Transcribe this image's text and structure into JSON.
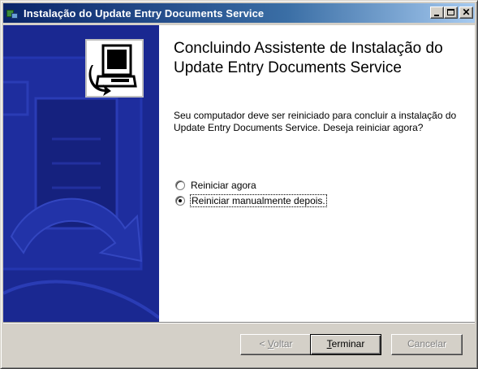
{
  "window": {
    "title": "Instalação do Update Entry Documents Service",
    "controls": [
      "minimize-icon",
      "maximize-icon",
      "close-icon"
    ]
  },
  "banner": {
    "logo_icon": "computer-install-icon",
    "colors": {
      "background": "#1c2a93",
      "accent": "#2233a8"
    }
  },
  "main": {
    "heading": "Concluindo Assistente de Instalação do Update Entry Documents Service",
    "description": "Seu computador deve ser reiniciado para concluir a instalação do Update Entry Documents Service. Deseja reiniciar agora?",
    "options": [
      {
        "label": "Reiniciar agora",
        "checked": false
      },
      {
        "label": "Reiniciar manualmente depois.",
        "checked": true
      }
    ]
  },
  "buttons": {
    "back": {
      "prefix": "< ",
      "accel": "V",
      "rest": "oltar",
      "enabled": false
    },
    "finish": {
      "accel": "T",
      "rest": "erminar",
      "enabled": true
    },
    "cancel": {
      "label": "Cancelar",
      "enabled": false
    }
  }
}
